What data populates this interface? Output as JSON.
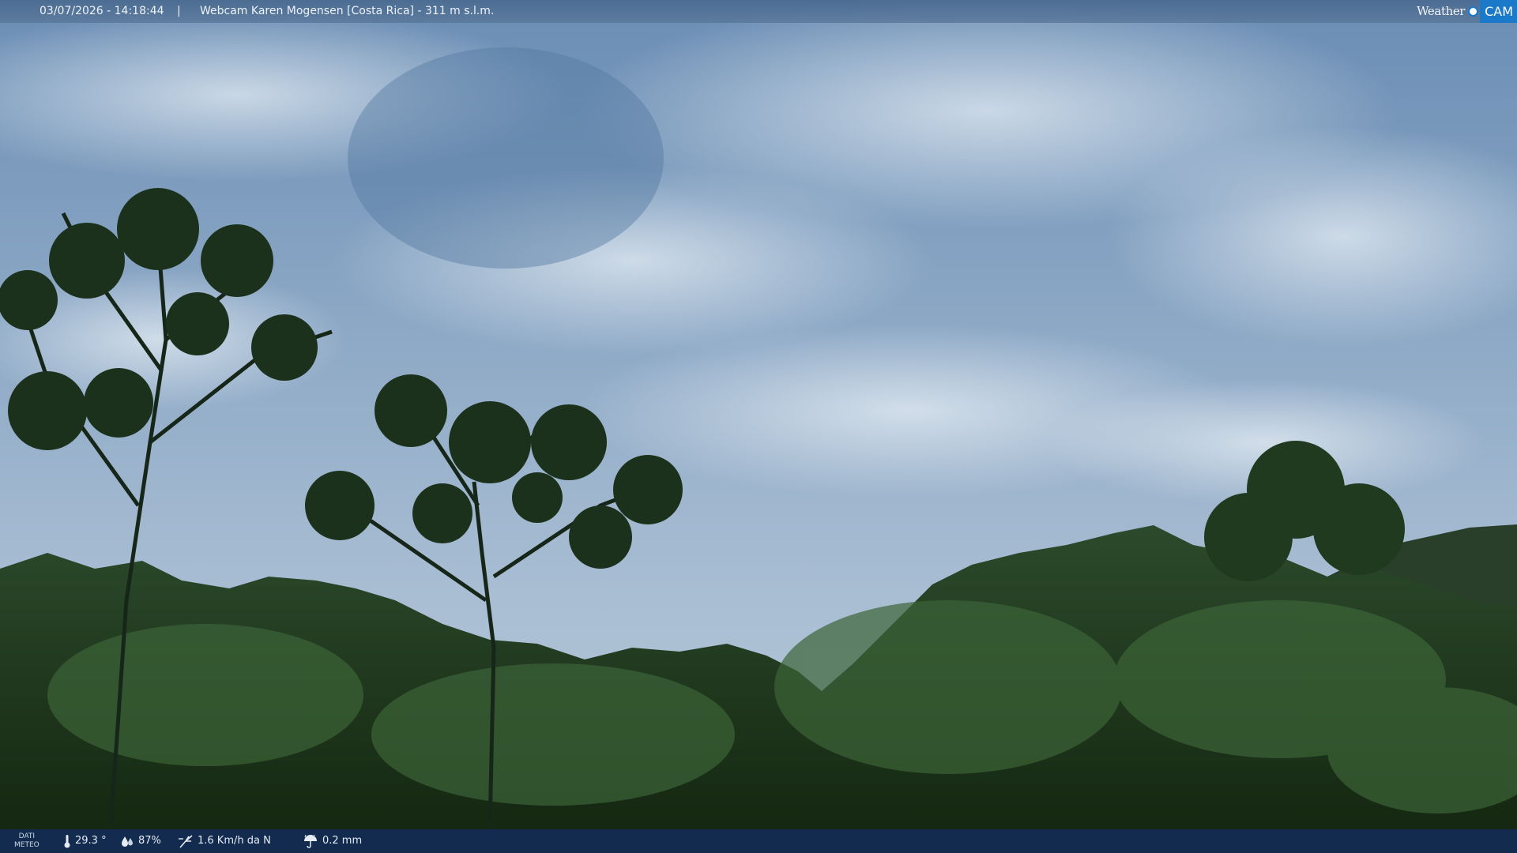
{
  "overlay": {
    "timestamp": "03/07/2026 - 14:18:44",
    "separator": "|",
    "title": "Webcam Karen Mogensen [Costa Rica]  - 311 m s.l.m."
  },
  "logo": {
    "weather": "Weather",
    "cam": "CAM"
  },
  "weather": {
    "label_line1": "DATI",
    "label_line2": "METEO",
    "temperature": "29.3 °",
    "humidity": "87%",
    "wind": "1.6 Km/h da N",
    "rain": "0.2 mm",
    "icons": {
      "temperature": "thermometer-icon",
      "humidity": "droplets-icon",
      "wind": "wind-vane-icon",
      "rain": "umbrella-rain-icon"
    }
  },
  "colors": {
    "top_bar": "#4f7197",
    "bottom_bar": "#132c54",
    "logo_accent": "#1a79c9"
  }
}
